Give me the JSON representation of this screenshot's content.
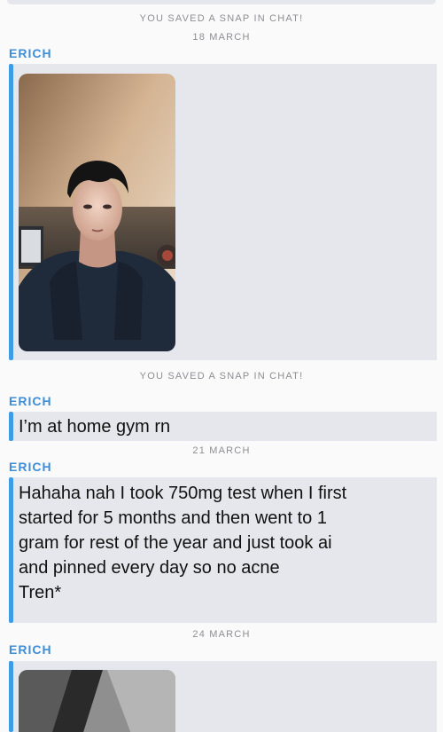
{
  "chat": {
    "system_saved_snap_1": "YOU SAVED A SNAP IN CHAT!",
    "date_1": "18 MARCH",
    "sender_1": "ERICH",
    "system_saved_snap_2": "YOU SAVED A SNAP IN CHAT!",
    "sender_2": "ERICH",
    "message_1": "I’m at home gym rn",
    "date_2": "21 MARCH",
    "sender_3": "ERICH",
    "message_2": "Hahaha nah I took 750mg test when I first\nstarted for 5 months and then went to 1\ngram for rest of the year and just took ai\nand pinned every day so no acne\nTren*",
    "date_3": "24 MARCH",
    "sender_4": "ERICH"
  },
  "colors": {
    "accent_blue": "#3e9be6",
    "sender_blue": "#3e8ed8",
    "bubble_gray": "#e5e7ec",
    "system_gray": "#8e8e93"
  }
}
